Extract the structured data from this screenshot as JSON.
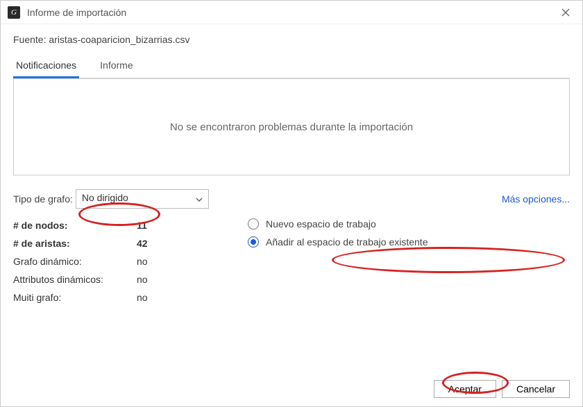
{
  "titlebar": {
    "title": "Informe de importación"
  },
  "source": {
    "label": "Fuente:",
    "value": "aristas-coaparicion_bizarrias.csv"
  },
  "tabs": {
    "notifications": "Notificaciones",
    "report": "Informe"
  },
  "panel": {
    "message": "No se encontraron problemas durante la importación"
  },
  "graphType": {
    "label": "Tipo de grafo:",
    "value": "No dirigido",
    "moreOptions": "Más opciones..."
  },
  "stats": {
    "nodesLabel": "# de nodos:",
    "nodesValue": "11",
    "edgesLabel": "# de aristas:",
    "edgesValue": "42",
    "dynGraphLabel": "Grafo dinámico:",
    "dynGraphValue": "no",
    "dynAttrsLabel": "Attributos dinámicos:",
    "dynAttrsValue": "no",
    "multiGraphLabel": "Muiti grafo:",
    "multiGraphValue": "no"
  },
  "workspace": {
    "newLabel": "Nuevo espacio de trabajo",
    "addLabel": "Añadir al espacio de trabajo existente"
  },
  "footer": {
    "ok": "Aceptar",
    "cancel": "Cancelar"
  }
}
